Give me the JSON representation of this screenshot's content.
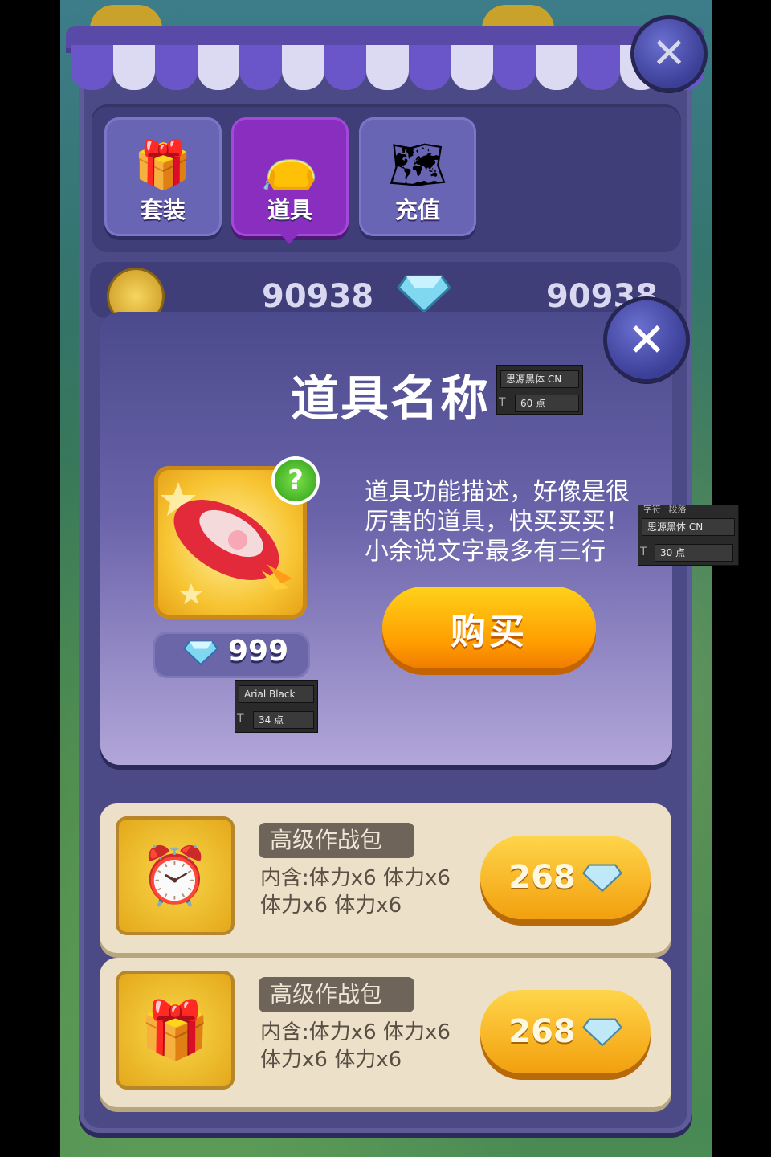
{
  "shop": {
    "close_icon": "close-icon",
    "tabs": [
      {
        "label": "套装",
        "icon": "gift-box-icon"
      },
      {
        "label": "道具",
        "icon": "lucky-bag-icon"
      },
      {
        "label": "充值",
        "icon": "treasure-map-icon"
      }
    ],
    "active_tab": 1,
    "coins": "90938",
    "gems": "90938",
    "items": [
      {
        "title": "高级作战包",
        "desc_line1": "内含:体力x6  体力x6",
        "desc_line2": "体力x6  体力x6",
        "price": "268",
        "icon": "clock-icon"
      },
      {
        "title": "高级作战包",
        "desc_line1": "内含:体力x6  体力x6",
        "desc_line2": "体力x6  体力x6",
        "price": "268",
        "icon": "gift-box-icon"
      }
    ]
  },
  "modal": {
    "title": "道具名称",
    "item_icon": "rocket-icon",
    "help_mark": "?",
    "price": "999",
    "desc_line1": "道具功能描述，好像是很",
    "desc_line2": "厉害的道具，快买买买！",
    "desc_line3": "小余说文字最多有三行",
    "buy_label": "购买"
  },
  "annotations": {
    "title_font": "思源黑体 CN",
    "title_size": "60 点",
    "desc_tab_chars": "字符",
    "desc_tab_para": "段落",
    "desc_font": "思源黑体 CN",
    "desc_size": "30 点",
    "price_font": "Arial Black",
    "price_size": "34 点"
  },
  "colors": {
    "panel": "#4b4a86",
    "tab_active": "#8a2ec0",
    "buy_button": "#ff9c00",
    "list_bg": "#ece1c8"
  }
}
